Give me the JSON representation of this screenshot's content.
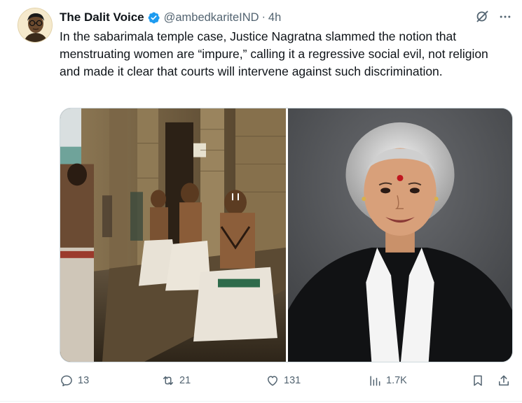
{
  "author": {
    "display_name": "The Dalit Voice",
    "handle": "@ambedkariteIND",
    "separator": "·",
    "time": "4h"
  },
  "tweet": {
    "text": "In the sabarimala temple case, Justice Nagratna slammed the notion that menstruating women are “impure,” calling it a regressive social evil, not religion and made it clear that courts will intervene against such discrimination."
  },
  "header_icons": [
    "grok-icon",
    "more-icon"
  ],
  "actions": {
    "replies": "13",
    "reposts": "21",
    "likes": "131",
    "views": "1.7K"
  },
  "colors": {
    "text": "#0f1419",
    "secondary": "#536471",
    "verified": "#1d9bf0",
    "border": "#cfd9de"
  }
}
